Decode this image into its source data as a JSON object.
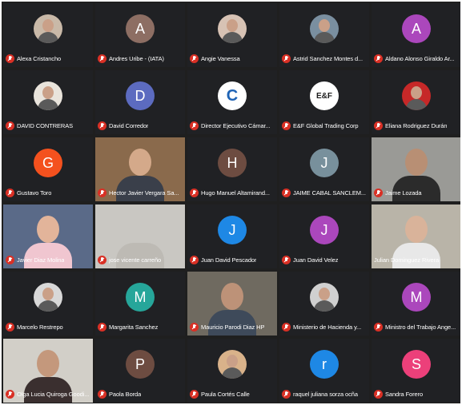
{
  "participants": [
    {
      "name": "Alexa Cristancho",
      "avatar_type": "photo",
      "avatar_color": "#c9b9a8",
      "muted": true
    },
    {
      "name": "Andres Uribe - (IATA)",
      "avatar_type": "letter",
      "letter": "A",
      "avatar_color": "#8d6e63",
      "muted": true
    },
    {
      "name": "Angie Vanessa",
      "avatar_type": "photo",
      "avatar_color": "#d7c2b4",
      "muted": true
    },
    {
      "name": "Astrid Sanchez Montes d...",
      "avatar_type": "photo",
      "avatar_color": "#7a8fa0",
      "muted": true
    },
    {
      "name": "Aldano Alonso Giraldo Ar...",
      "avatar_type": "letter",
      "letter": "A",
      "avatar_color": "#ab47bc",
      "muted": true
    },
    {
      "name": "DAVID CONTRERAS",
      "avatar_type": "photo",
      "avatar_color": "#e9e4dc",
      "muted": true
    },
    {
      "name": "David Corredor",
      "avatar_type": "letter",
      "letter": "D",
      "avatar_color": "#5c6bc0",
      "muted": true
    },
    {
      "name": "Director Ejecutivo Cámar...",
      "avatar_type": "logo",
      "logo": "C",
      "avatar_color": "#ffffff",
      "muted": true
    },
    {
      "name": "E&F Global Trading Corp",
      "avatar_type": "logo",
      "logo": "E&F",
      "avatar_color": "#ffffff",
      "muted": true
    },
    {
      "name": "Eliana Rodriguez Durán",
      "avatar_type": "photo",
      "avatar_color": "#c62828",
      "muted": true
    },
    {
      "name": "Gustavo Toro",
      "avatar_type": "letter",
      "letter": "G",
      "avatar_color": "#f4511e",
      "muted": true
    },
    {
      "name": "Hector Javier Vergara Sa...",
      "avatar_type": "video",
      "bg": "#8a6a4c",
      "skin": "#d4a98a",
      "clothes": "#3a3f4a",
      "muted": true
    },
    {
      "name": "Hugo Manuel Altamirand...",
      "avatar_type": "letter",
      "letter": "H",
      "avatar_color": "#6d4c41",
      "muted": true
    },
    {
      "name": "JAIME CABAL SANCLEM...",
      "avatar_type": "letter",
      "letter": "J",
      "avatar_color": "#78909c",
      "muted": true
    },
    {
      "name": "Jaime Lozada",
      "avatar_type": "video",
      "bg": "#9a9a96",
      "skin": "#b88f74",
      "clothes": "#2b2b2b",
      "muted": true
    },
    {
      "name": "Javier Diaz Molina",
      "avatar_type": "video",
      "bg": "#5a6a88",
      "skin": "#e2b49a",
      "clothes": "#f0c6d0",
      "muted": true
    },
    {
      "name": "jose vicente carreño",
      "avatar_type": "video",
      "bg": "#c9c7c2",
      "skin": "#c9c7c2",
      "clothes": "#bdbab4",
      "muted": true
    },
    {
      "name": "Juan David Pescador",
      "avatar_type": "letter",
      "letter": "J",
      "avatar_color": "#1e88e5",
      "muted": true
    },
    {
      "name": "Juan David Velez",
      "avatar_type": "letter",
      "letter": "J",
      "avatar_color": "#ab47bc",
      "muted": true
    },
    {
      "name": "Julian Dominguez Rivera",
      "avatar_type": "video",
      "bg": "#b9b4a8",
      "skin": "#d9b39a",
      "clothes": "#e8e8e8",
      "muted": false
    },
    {
      "name": "Marcelo Restrepo",
      "avatar_type": "photo",
      "avatar_color": "#d8d8d8",
      "muted": true
    },
    {
      "name": "Margarita Sanchez",
      "avatar_type": "letter",
      "letter": "M",
      "avatar_color": "#26a69a",
      "muted": true
    },
    {
      "name": "Mauricio Parodi Diaz HP",
      "avatar_type": "video",
      "bg": "#6f6a60",
      "skin": "#bd9278",
      "clothes": "#3e4a5a",
      "muted": true
    },
    {
      "name": "Ministerio de Hacienda y...",
      "avatar_type": "photo",
      "avatar_color": "#d0d0d0",
      "muted": true
    },
    {
      "name": "Ministro del Trabajo Ange...",
      "avatar_type": "letter",
      "letter": "M",
      "avatar_color": "#ab47bc",
      "muted": true
    },
    {
      "name": "Olga Lucia Quiroga Goodi...",
      "avatar_type": "video",
      "bg": "#d2cfc8",
      "skin": "#c4987c",
      "clothes": "#3a2f2f",
      "muted": true
    },
    {
      "name": "Paola Borda",
      "avatar_type": "letter",
      "letter": "P",
      "avatar_color": "#6d4c41",
      "muted": true
    },
    {
      "name": "Paula Cortés Calle",
      "avatar_type": "photo",
      "avatar_color": "#d9b28a",
      "muted": true
    },
    {
      "name": "raquel juliana sorza ocña",
      "avatar_type": "letter",
      "letter": "r",
      "avatar_color": "#1e88e5",
      "muted": true
    },
    {
      "name": "Sandra Forero",
      "avatar_type": "letter",
      "letter": "S",
      "avatar_color": "#ec407a",
      "muted": true
    }
  ]
}
